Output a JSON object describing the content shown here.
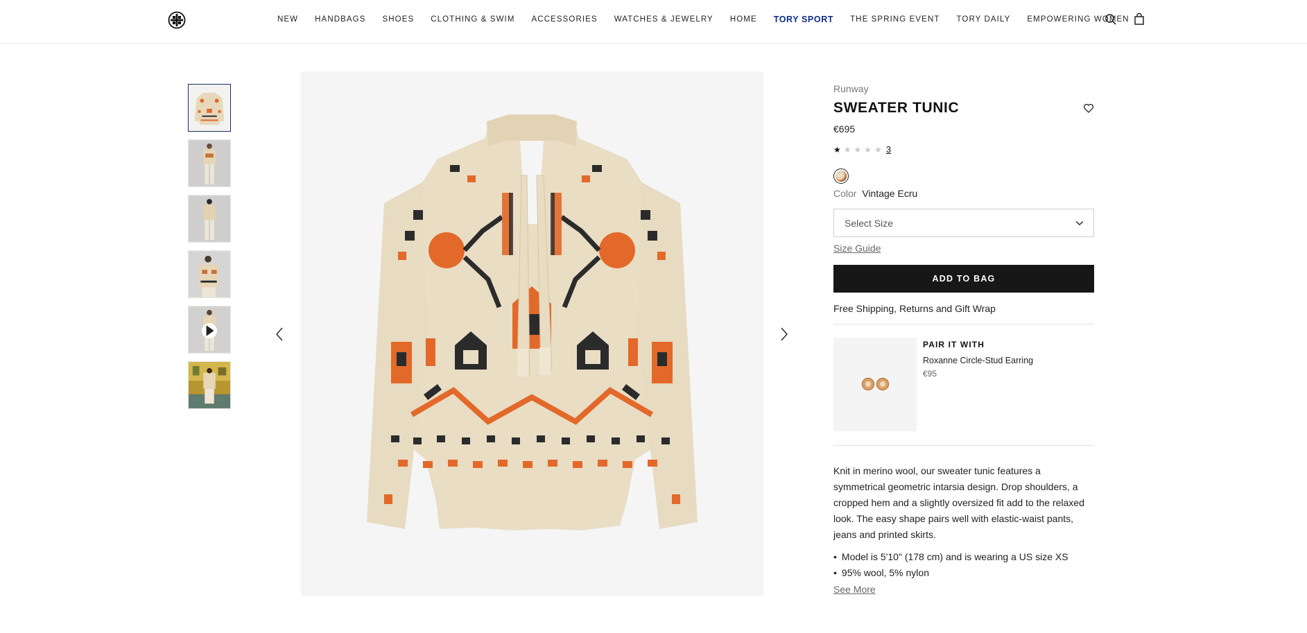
{
  "header": {
    "logo": "tory-burch-logo",
    "nav": [
      "New",
      "Handbags",
      "Shoes",
      "Clothing & Swim",
      "Accessories",
      "Watches & Jewelry",
      "Home",
      "Tory Sport",
      "The Spring Event",
      "Tory Daily",
      "Empowering Women"
    ],
    "icons": [
      "search-icon",
      "shopping-bag-icon"
    ]
  },
  "gallery": {
    "thumbnails": 6,
    "active_index": 0,
    "video_thumbnail_index": 4
  },
  "product": {
    "collection": "Runway",
    "title": "SWEATER TUNIC",
    "price": "€695",
    "rating": 1,
    "rating_max": 5,
    "review_count": "3",
    "color_label": "Color",
    "color_value": "Vintage Ecru",
    "size_placeholder": "Select Size",
    "size_guide": "Size Guide",
    "add_to_bag": "ADD TO BAG",
    "shipping": "Free Shipping, Returns and Gift Wrap"
  },
  "pair": {
    "heading": "PAIR IT WITH",
    "name": "Roxanne Circle-Stud Earring",
    "price": "€95"
  },
  "details": {
    "description": "Knit in merino wool, our sweater tunic features a symmetrical geometric intarsia design. Drop shoulders, a cropped hem and a slightly oversized fit add to the relaxed look. The easy shape pairs well with elastic-waist pants, jeans and printed skirts.",
    "bullets": [
      "Model is 5'10\" (178 cm) and is wearing a US size XS",
      "95% wool, 5% nylon"
    ],
    "see_more": "See More"
  },
  "colors": {
    "accent": "#0f2c8c",
    "button": "#171717",
    "sweater_base": "#e9dcc0",
    "sweater_orange": "#e2692a",
    "sweater_black": "#2b2b2b"
  }
}
